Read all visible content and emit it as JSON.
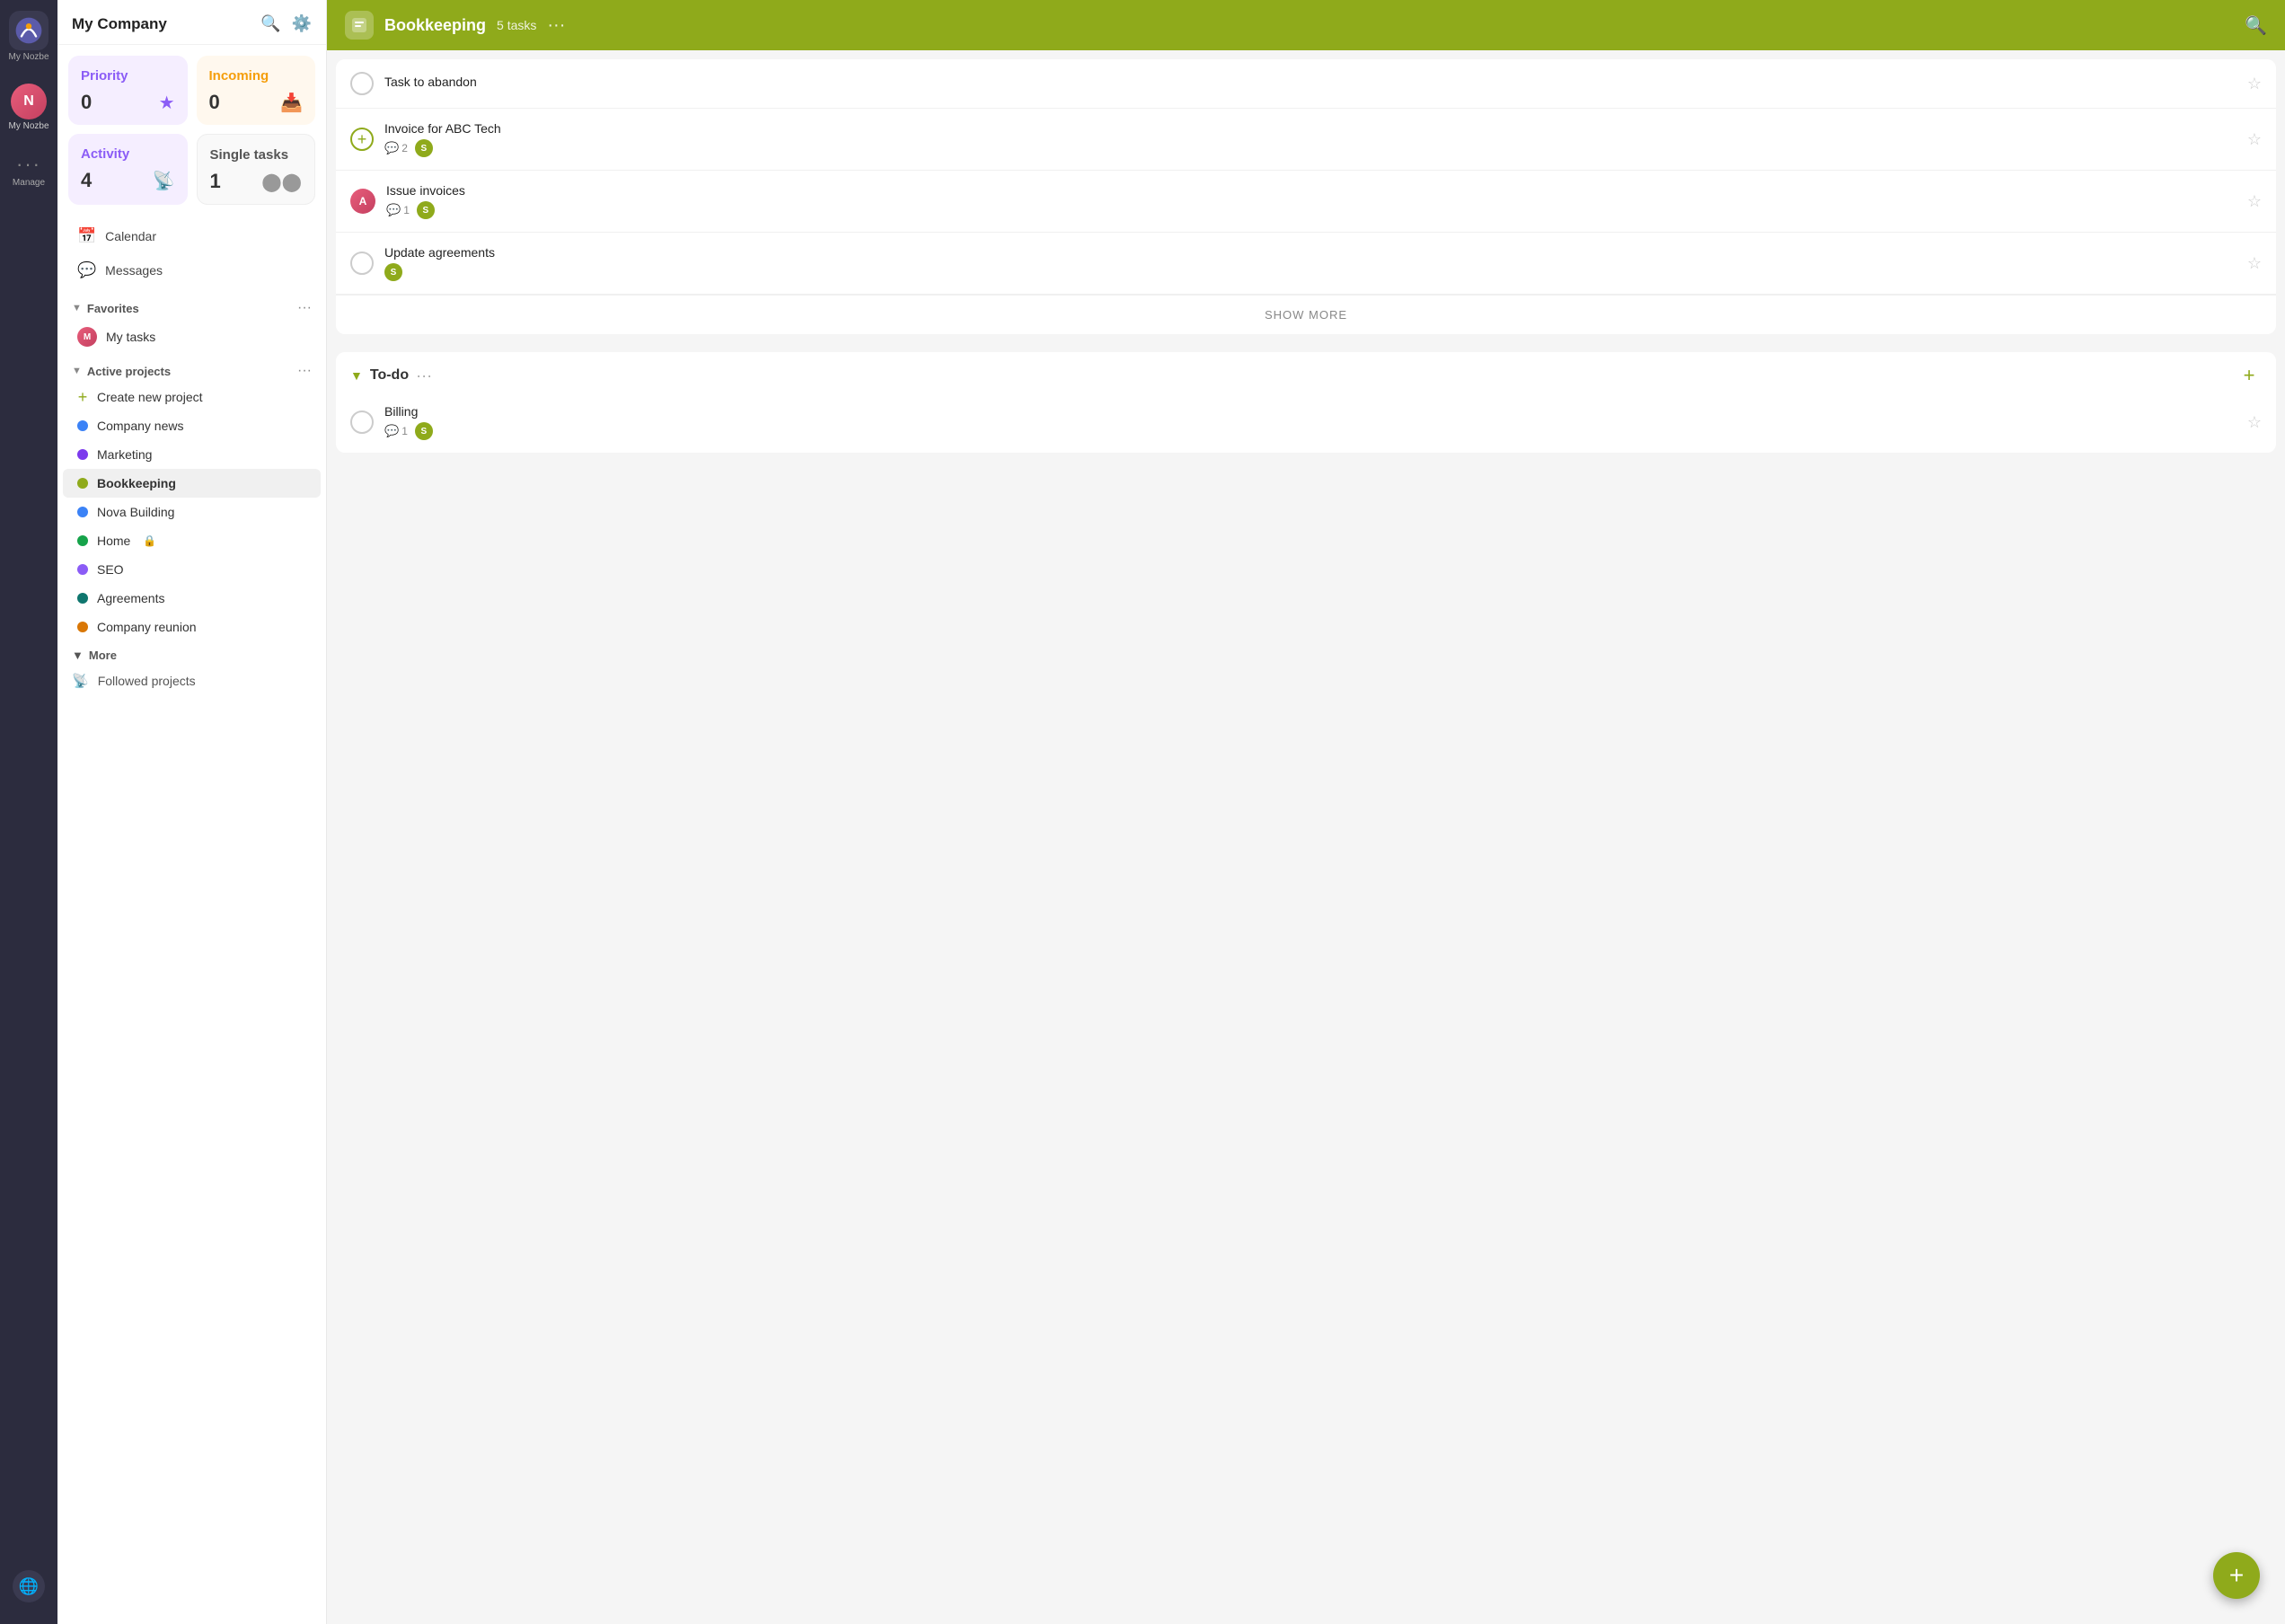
{
  "app": {
    "company_name": "My Company",
    "logo_initials": "N"
  },
  "icon_bar": {
    "my_nozbe_label": "My Nozbe",
    "manage_label": "Manage"
  },
  "sidebar": {
    "search_tooltip": "Search",
    "settings_tooltip": "Settings",
    "priority_card": {
      "title": "Priority",
      "count": "0",
      "icon": "★"
    },
    "incoming_card": {
      "title": "Incoming",
      "count": "0",
      "icon": "📥"
    },
    "activity_card": {
      "title": "Activity",
      "count": "4",
      "icon": "📡"
    },
    "single_card": {
      "title": "Single tasks",
      "count": "1",
      "icon": "⬤⬤"
    },
    "nav_items": [
      {
        "id": "calendar",
        "label": "Calendar",
        "icon": "📅"
      },
      {
        "id": "messages",
        "label": "Messages",
        "icon": "💬"
      }
    ],
    "favorites": {
      "label": "Favorites",
      "items": [
        {
          "id": "my-tasks",
          "label": "My tasks",
          "has_avatar": true
        }
      ]
    },
    "active_projects": {
      "label": "Active projects",
      "create_label": "Create new project",
      "items": [
        {
          "id": "company-news",
          "label": "Company news",
          "color": "#3b82f6",
          "active": false
        },
        {
          "id": "marketing",
          "label": "Marketing",
          "color": "#7c3aed",
          "active": false
        },
        {
          "id": "bookkeeping",
          "label": "Bookkeeping",
          "color": "#8faa1b",
          "active": true
        },
        {
          "id": "nova-building",
          "label": "Nova Building",
          "color": "#3b82f6",
          "active": false
        },
        {
          "id": "home",
          "label": "Home",
          "color": "#16a34a",
          "active": false,
          "lock": true
        },
        {
          "id": "seo",
          "label": "SEO",
          "color": "#8b5cf6",
          "active": false
        },
        {
          "id": "agreements",
          "label": "Agreements",
          "color": "#0f766e",
          "active": false
        },
        {
          "id": "company-reunion",
          "label": "Company reunion",
          "color": "#d97706",
          "active": false
        }
      ]
    },
    "more": {
      "label": "More",
      "followed_projects_label": "Followed projects"
    }
  },
  "main": {
    "header": {
      "project_name": "Bookkeeping",
      "task_count": "5 tasks",
      "dots_label": "···"
    },
    "sections": [
      {
        "id": "default",
        "tasks": [
          {
            "id": "task-1",
            "title": "Task to abandon",
            "has_avatar": false,
            "comments": null,
            "has_badge": false
          },
          {
            "id": "task-2",
            "title": "Invoice for ABC Tech",
            "has_avatar": false,
            "comments": "2",
            "has_badge": true,
            "is_add_type": true
          },
          {
            "id": "task-3",
            "title": "Issue invoices",
            "has_avatar": true,
            "comments": "1",
            "has_badge": true
          },
          {
            "id": "task-4",
            "title": "Update agreements",
            "has_avatar": false,
            "comments": null,
            "has_badge": true
          }
        ],
        "show_more": "SHOW MORE"
      },
      {
        "id": "todo",
        "title": "To-do",
        "tasks": [
          {
            "id": "task-5",
            "title": "Billing",
            "has_avatar": false,
            "comments": "1",
            "has_badge": true
          }
        ]
      }
    ],
    "fab_label": "+"
  }
}
